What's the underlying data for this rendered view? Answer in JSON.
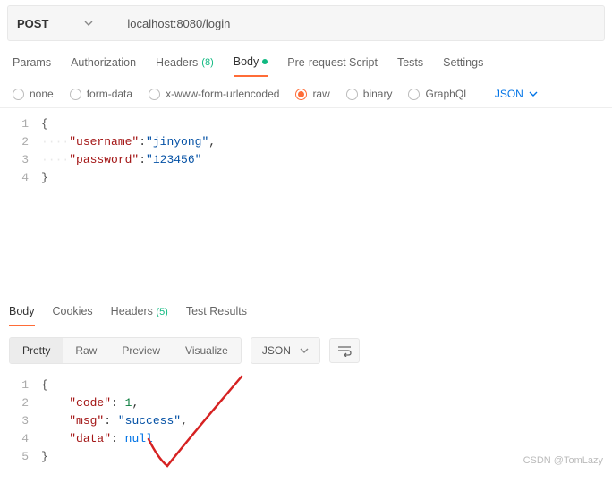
{
  "request": {
    "method": "POST",
    "url": "localhost:8080/login"
  },
  "tabs": {
    "params": "Params",
    "auth": "Authorization",
    "headers": "Headers",
    "headers_count": "(8)",
    "body": "Body",
    "prerequest": "Pre-request Script",
    "tests": "Tests",
    "settings": "Settings"
  },
  "body_types": {
    "none": "none",
    "formdata": "form-data",
    "xwww": "x-www-form-urlencoded",
    "raw": "raw",
    "binary": "binary",
    "graphql": "GraphQL",
    "lang": "JSON"
  },
  "req_body": {
    "gutter": [
      "1",
      "2",
      "3",
      "4"
    ],
    "l1": "{",
    "l2_key": "\"username\"",
    "l2_val": "\"jinyong\"",
    "l3_key": "\"password\"",
    "l3_val": "\"123456\"",
    "l4": "}"
  },
  "resp_tabs": {
    "body": "Body",
    "cookies": "Cookies",
    "headers": "Headers",
    "headers_count": "(5)",
    "testresults": "Test Results"
  },
  "view": {
    "pretty": "Pretty",
    "raw": "Raw",
    "preview": "Preview",
    "visualize": "Visualize",
    "lang": "JSON"
  },
  "resp_body": {
    "gutter": [
      "1",
      "2",
      "3",
      "4",
      "5"
    ],
    "l1": "{",
    "l2_key": "\"code\"",
    "l2_val": "1",
    "l3_key": "\"msg\"",
    "l3_val": "\"success\"",
    "l4_key": "\"data\"",
    "l4_val": "null",
    "l5": "}"
  },
  "watermark": "CSDN @TomLazy"
}
